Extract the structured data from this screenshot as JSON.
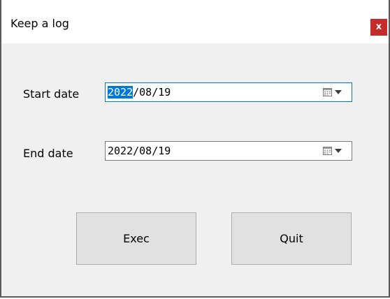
{
  "window": {
    "title": "Keep a log",
    "close_label": "x"
  },
  "form": {
    "start_date": {
      "label": "Start date",
      "value_selected": "2022",
      "value_rest": "/08/19"
    },
    "end_date": {
      "label": "End date",
      "value": "2022/08/19"
    }
  },
  "buttons": {
    "exec_label": "Exec",
    "quit_label": "Quit"
  },
  "colors": {
    "close_button": "#c42b2b",
    "focus_border": "#0078d7",
    "selection": "#0078d7",
    "dialog_background": "#f0f0f0"
  }
}
